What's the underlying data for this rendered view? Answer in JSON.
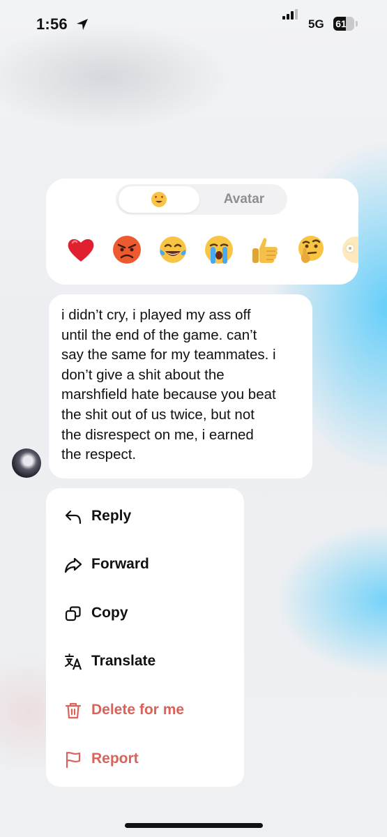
{
  "status_bar": {
    "time": "1:56",
    "network": "5G",
    "battery": "61",
    "battery_level": 0.61,
    "icons": [
      "location-arrow-icon",
      "cellular-signal-icon"
    ]
  },
  "reaction_panel": {
    "tabs": [
      {
        "icon": "heart-eyes-emoji",
        "selected": true
      },
      {
        "label": "Avatar",
        "selected": false
      }
    ],
    "emojis": [
      {
        "name": "red-heart",
        "char": "❤️"
      },
      {
        "name": "angry-face",
        "char": "😡"
      },
      {
        "name": "tears-of-joy",
        "char": "😂"
      },
      {
        "name": "loudly-crying",
        "char": "😭"
      },
      {
        "name": "thumbs-up",
        "char": "👍"
      },
      {
        "name": "thinking-face",
        "char": "🤔"
      },
      {
        "name": "face-partially-visible",
        "char": "😳"
      }
    ]
  },
  "message": {
    "text_lines": [
      "i didn’t cry, i played my ass off",
      "until the end of the game. can’t",
      "say the same for my teammates. i",
      "don’t give a shit about the",
      "marshfield hate because you beat",
      "the shit out of us twice, but not",
      "the disrespect on me, i earned",
      "the respect."
    ]
  },
  "menu": {
    "items": [
      {
        "label": "Reply",
        "icon": "reply-arrow-icon",
        "danger": false
      },
      {
        "label": "Forward",
        "icon": "forward-arrow-icon",
        "danger": false
      },
      {
        "label": "Copy",
        "icon": "copy-icon",
        "danger": false
      },
      {
        "label": "Translate",
        "icon": "translate-icon",
        "danger": false
      },
      {
        "label": "Delete for me",
        "icon": "trash-icon",
        "danger": true
      },
      {
        "label": "Report",
        "icon": "flag-icon",
        "danger": true
      }
    ]
  },
  "colors": {
    "danger": "#d9625a",
    "muted": "#8e8e93",
    "accent_background": "#5fcdfa"
  }
}
